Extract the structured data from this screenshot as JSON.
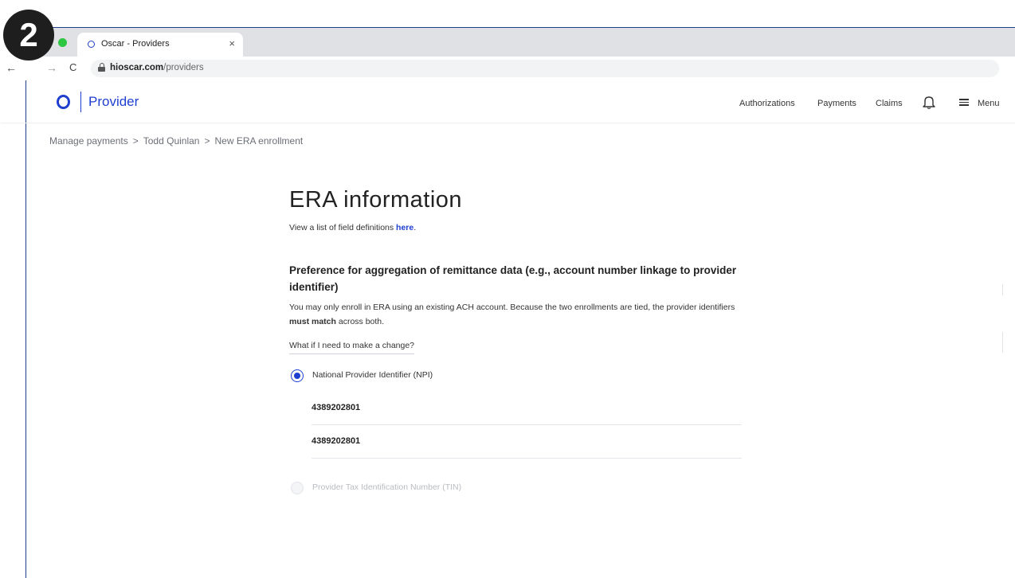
{
  "step_badge": "2",
  "browser": {
    "tab": {
      "title": "Oscar - Providers",
      "close": "×"
    },
    "nav": {
      "back": "←",
      "forward": "→",
      "reload": "C"
    },
    "url": {
      "host": "hioscar.com",
      "path": "/providers"
    }
  },
  "header": {
    "logo_text": "Provider",
    "links": [
      "Authorizations",
      "Payments",
      "Claims"
    ],
    "menu_label": "Menu"
  },
  "breadcrumb": {
    "items": [
      "Manage payments",
      "Todd Quinlan",
      "New ERA enrollment"
    ],
    "separator": ">"
  },
  "main": {
    "title": "ERA information",
    "subtitle_prefix": "View a list of field definitions ",
    "subtitle_link": "here",
    "subtitle_suffix": ".",
    "section_heading": "Preference for aggregation of remittance data (e.g., account number linkage to provider identifier)",
    "section_body_prefix": "You may only enroll in ERA using an existing ACH account. Because the two enrollments are tied, the provider identifiers ",
    "section_body_bold": "must match",
    "section_body_suffix": " across both.",
    "help_link": "What if I need to make a change?",
    "options": {
      "npi_label": "National Provider Identifier (NPI)",
      "npi_values": [
        "4389202801",
        "4389202801"
      ],
      "tin_label": "Provider Tax Identification Number (TIN)"
    }
  },
  "colors": {
    "brand": "#1f3fd0",
    "tabstrip": "#dfe1e5",
    "badge": "#1e1e1e"
  }
}
